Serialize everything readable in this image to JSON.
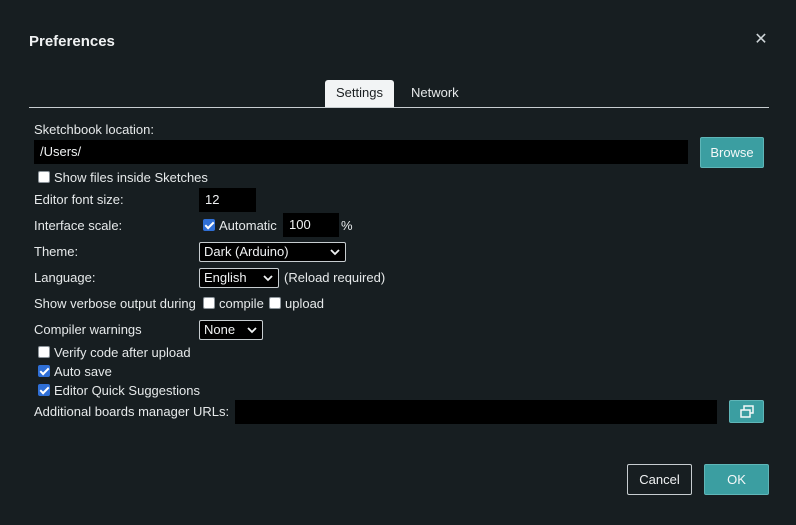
{
  "dialog": {
    "title": "Preferences",
    "close_icon": "close-icon"
  },
  "tabs": [
    {
      "label": "Settings",
      "active": true
    },
    {
      "label": "Network",
      "active": false
    }
  ],
  "sketchbook": {
    "label": "Sketchbook location:",
    "value": "/Users/",
    "browse_label": "Browse"
  },
  "show_files": {
    "label": "Show files inside Sketches",
    "checked": false
  },
  "font_size": {
    "label": "Editor font size:",
    "value": "12"
  },
  "interface_scale": {
    "label": "Interface scale:",
    "automatic_label": "Automatic",
    "automatic_checked": true,
    "value": "100",
    "unit": "%"
  },
  "theme": {
    "label": "Theme:",
    "value": "Dark (Arduino)"
  },
  "language": {
    "label": "Language:",
    "value": "English",
    "note": "(Reload required)"
  },
  "verbose": {
    "label": "Show verbose output during",
    "compile_label": "compile",
    "compile_checked": false,
    "upload_label": "upload",
    "upload_checked": false
  },
  "compiler_warnings": {
    "label": "Compiler warnings",
    "value": "None"
  },
  "verify": {
    "label": "Verify code after upload",
    "checked": false
  },
  "auto_save": {
    "label": "Auto save",
    "checked": true
  },
  "quick_suggestions": {
    "label": "Editor Quick Suggestions",
    "checked": true
  },
  "boards_urls": {
    "label": "Additional boards manager URLs:",
    "value": "",
    "edit_icon": "open-in-window-icon"
  },
  "footer": {
    "cancel_label": "Cancel",
    "ok_label": "OK"
  },
  "colors": {
    "background": "#171e21",
    "accent": "#3b9ea1",
    "checkbox": "#2f6fd6"
  }
}
